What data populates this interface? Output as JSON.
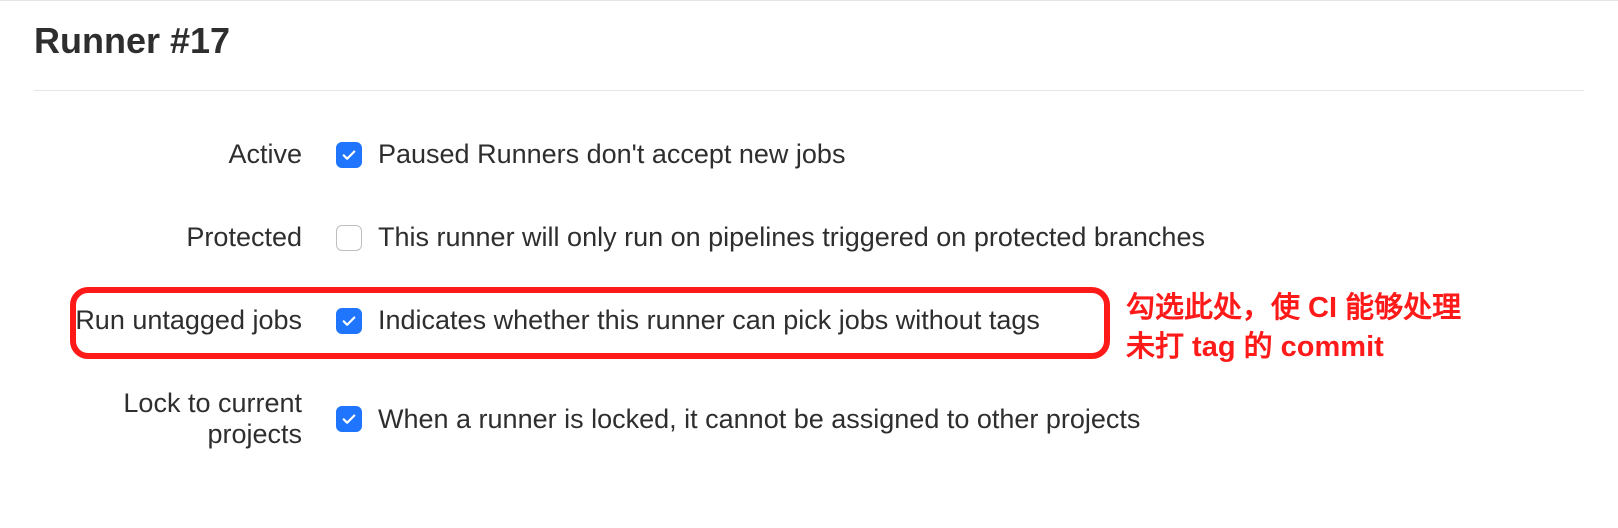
{
  "page": {
    "title": "Runner #17"
  },
  "form": {
    "active": {
      "label": "Active",
      "checked": true,
      "desc": "Paused Runners don't accept new jobs"
    },
    "protected": {
      "label": "Protected",
      "checked": false,
      "desc": "This runner will only run on pipelines triggered on protected branches"
    },
    "untagged": {
      "label": "Run untagged jobs",
      "checked": true,
      "desc": "Indicates whether this runner can pick jobs without tags"
    },
    "lock": {
      "label": "Lock to current projects",
      "checked": true,
      "desc": "When a runner is locked, it cannot be assigned to other projects"
    }
  },
  "annotation": {
    "text": "勾选此处，使 CI 能够处理\n未打 tag 的 commit"
  },
  "colors": {
    "accent": "#1f75fe",
    "highlight": "#ff1a1a"
  }
}
